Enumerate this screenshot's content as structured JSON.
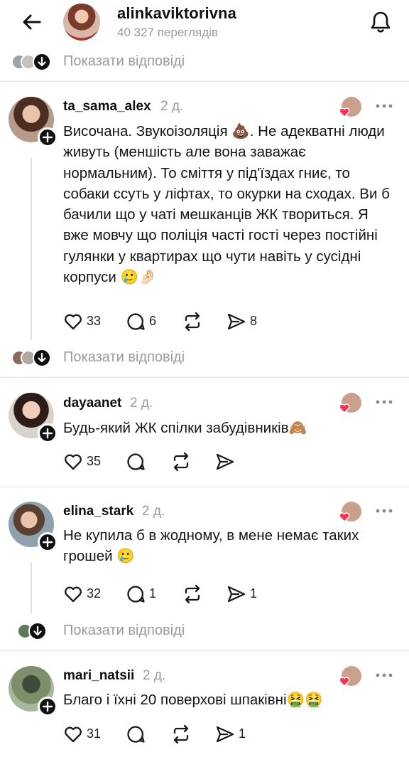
{
  "header": {
    "username": "alinkaviktorivna",
    "views": "40 327 переглядів",
    "back_icon": "arrow-left-icon",
    "bell_icon": "bell-icon"
  },
  "show_replies_label": "Показати відповіді",
  "comments": [
    {
      "username": "ta_sama_alex",
      "time": "2 д.",
      "text": "Височана. Звукоізоляція 💩. Не адекватні люди живуть (меншість але вона заважає нормальним). То сміття у під'їздах гниє, то собаки ссуть у ліфтах, то окурки на сходах. Ви б бачили що у чаті мешканців ЖК твориться. Я вже мовчу що поліція часті гості через постійні гулянки у квартирах що чути навіть у сусідні корпуси 🥲🤌🏻",
      "likes": "33",
      "replies": "6",
      "reposts": "",
      "shares": "8"
    },
    {
      "username": "dayaanet",
      "time": "2 д.",
      "text": "Будь-який ЖК спілки забудівників🙈",
      "likes": "35",
      "replies": "",
      "reposts": "",
      "shares": ""
    },
    {
      "username": "elina_stark",
      "time": "2 д.",
      "text": "Не купила б в жодному, в мене немає таких грошей 🥲",
      "likes": "32",
      "replies": "1",
      "reposts": "",
      "shares": "1"
    },
    {
      "username": "mari_natsii",
      "time": "2 д.",
      "text": "Благо і їхні 20 поверхові шпаківні🤮🤮",
      "likes": "31",
      "replies": "",
      "reposts": "",
      "shares": "1"
    }
  ],
  "colors": {
    "text": "#101010",
    "muted": "#9a9a9a",
    "divider": "#e3e3e3",
    "heart_red": "#ff2f55"
  }
}
